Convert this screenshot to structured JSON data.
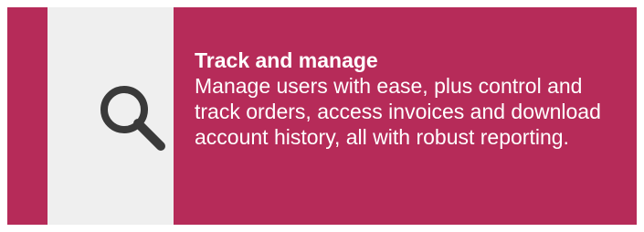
{
  "card": {
    "title": "Track and manage",
    "description": "Manage users with ease, plus control and track orders, access invoices and download account history, all with robust reporting.",
    "icon": "search-icon",
    "colors": {
      "background": "#b62b59",
      "icon_panel": "#efefef",
      "icon": "#3a3a3a",
      "text": "#ffffff"
    }
  }
}
